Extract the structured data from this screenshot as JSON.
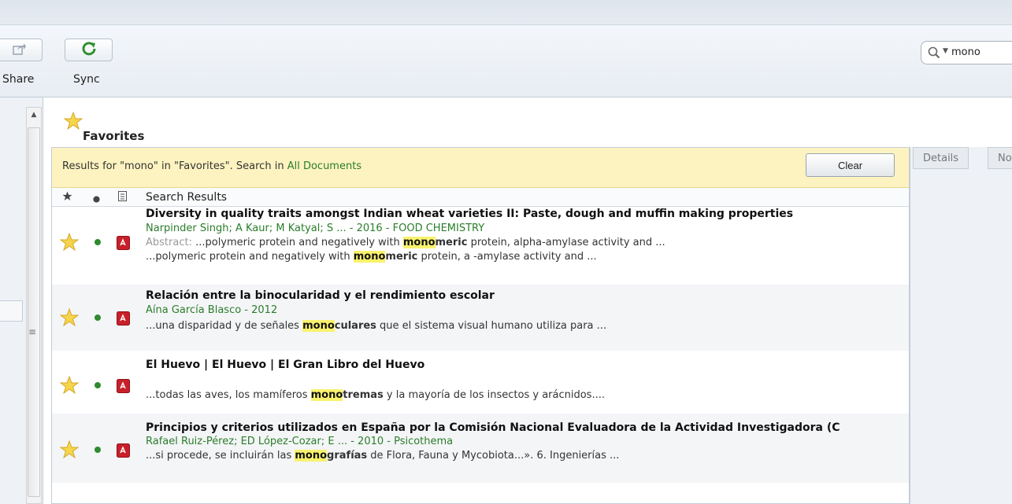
{
  "toolbar": {
    "share_label": "Share",
    "sync_label": "Sync",
    "search_value": "mono"
  },
  "collection": {
    "title": "Favorites"
  },
  "notice": {
    "prefix": "Results for \"mono\" in \"Favorites\". Search in ",
    "link": "All Documents",
    "clear_label": "Clear"
  },
  "columns": {
    "title": "Search Results"
  },
  "results": [
    {
      "title": "Diversity in quality traits amongst Indian wheat varieties II: Paste, dough and muffin making properties",
      "meta": "Narpinder Singh; A Kaur; M Katyal; S ... - 2016 - FOOD CHEMISTRY",
      "line1_label": "Abstract: ",
      "line1_pre": "...polymeric protein and negatively with ",
      "line1_hl": "mono",
      "line1_bold": "meric",
      "line1_post": " protein, alpha-amylase activity and ...",
      "line2_pre": "...polymeric protein and negatively with ",
      "line2_hl": "mono",
      "line2_bold": "meric",
      "line2_post": " protein, a -amylase activity and ..."
    },
    {
      "title": "Relación entre la binocularidad y el rendimiento escolar",
      "meta": "Aína García Blasco - 2012",
      "line1_pre": "...una disparidad y de señales ",
      "line1_hl": "mono",
      "line1_bold": "culares",
      "line1_post": " que el sistema visual humano utiliza para ..."
    },
    {
      "title": "El Huevo | El Huevo | El Gran Libro del Huevo",
      "line1_pre": "...todas las aves, los mamíferos ",
      "line1_hl": "mono",
      "line1_bold": "tremas",
      "line1_post": " y la mayoría de los insectos y arácnidos...."
    },
    {
      "title": "Principios y criterios utilizados en España por la Comisión Nacional Evaluadora de la Actividad Investigadora (C",
      "meta": "Rafael Ruiz-Pérez; ED López-Cozar; E ... - 2010 - Psicothema",
      "line1_pre": "...si procede, se incluirán las ",
      "line1_hl": "mono",
      "line1_bold": "grafías",
      "line1_post": " de Flora, Fauna y Mycobiota...». 6. Ingenierías ..."
    }
  ],
  "side_tabs": [
    "Details",
    "No"
  ],
  "colors": {
    "highlight": "#f9f26d",
    "author_green": "#2a7d2a",
    "notice_bg": "#fdf3c0"
  }
}
